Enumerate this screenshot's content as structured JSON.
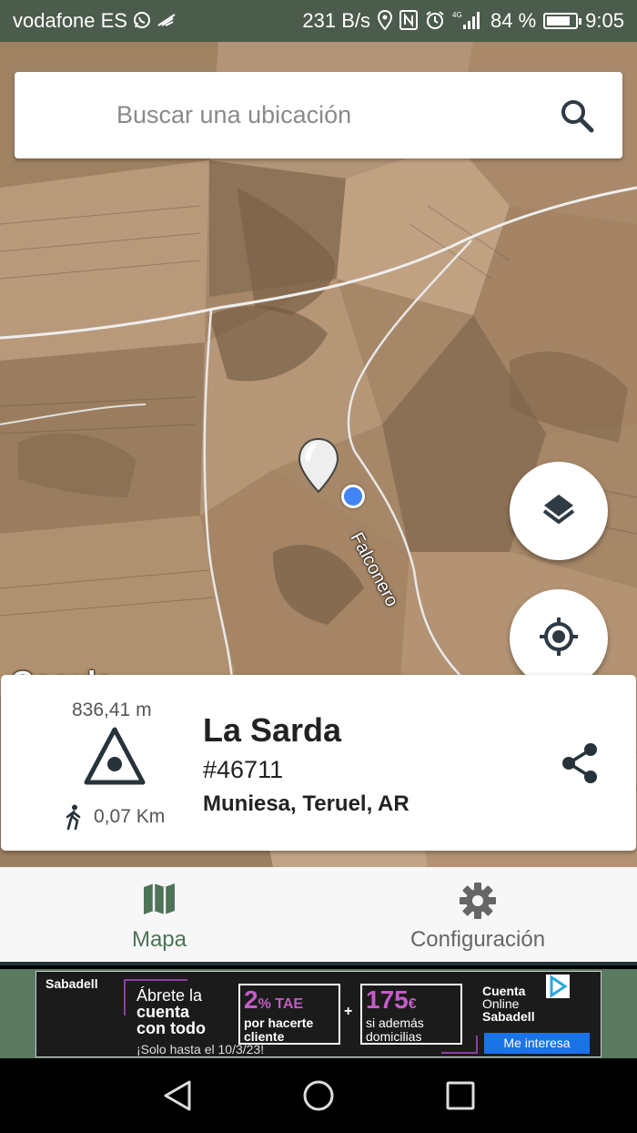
{
  "status_bar": {
    "carrier": "vodafone ES",
    "net_speed": "231 B/s",
    "network": "4G",
    "battery": "84 %",
    "battery_level": 0.84,
    "time": "9:05",
    "icons": [
      "whatsapp-icon",
      "wifi-off-icon",
      "location-icon",
      "nfc-icon",
      "alarm-icon",
      "signal-icon",
      "battery-icon"
    ]
  },
  "search": {
    "placeholder": "Buscar una ubicación"
  },
  "map": {
    "road_label": "Falconero",
    "attribution": "Google",
    "buttons": [
      "layers-icon",
      "my-location-icon"
    ]
  },
  "peak_card": {
    "altitude": "836,41 m",
    "distance": "0,07 Km",
    "name": "La Sarda",
    "id": "#46711",
    "location": "Muniesa, Teruel, AR",
    "icons": [
      "summit-icon",
      "walking-icon",
      "share-icon"
    ]
  },
  "tabs": [
    {
      "label": "Mapa",
      "icon": "map-icon",
      "active": true
    },
    {
      "label": "Configuración",
      "icon": "gear-icon",
      "active": false
    }
  ],
  "ad": {
    "brand": "Sabadell",
    "headline_1": "Ábrete la",
    "headline_2": "cuenta",
    "headline_3": "con todo",
    "fineprint": "¡Solo hasta el 10/3/23!",
    "offer1_big": "2",
    "offer1_unit": "% TAE",
    "offer1_text_1": "por hacerte",
    "offer1_text_2": "cliente",
    "offer2_big": "175",
    "offer2_unit": "€",
    "offer2_text_1": "si además",
    "offer2_text_2": "domicilias",
    "plus": "+",
    "right_1": "Cuenta",
    "right_2": "Online",
    "right_3": "Sabadell",
    "cta": "Me interesa"
  },
  "colors": {
    "status_bar": "#4c5c4c",
    "accent_green": "#4d7358",
    "location_blue": "#4285f4",
    "icon_dark": "#2e3a44",
    "ad_purple": "#c45cc7"
  }
}
